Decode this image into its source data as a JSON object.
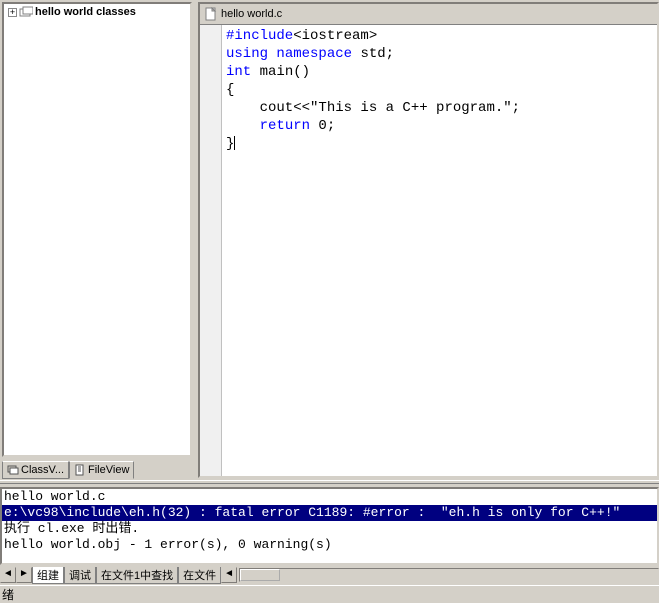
{
  "tree": {
    "expand_symbol": "+",
    "root_label": "hello world classes"
  },
  "editor": {
    "filename": "hello world.c",
    "code_tokens": [
      [
        {
          "t": "#include",
          "c": "kw"
        },
        {
          "t": "<iostream>",
          "c": ""
        }
      ],
      [
        {
          "t": "using",
          "c": "kw"
        },
        {
          "t": " ",
          "c": ""
        },
        {
          "t": "namespace",
          "c": "kw"
        },
        {
          "t": " std;",
          "c": ""
        }
      ],
      [
        {
          "t": "int",
          "c": "kw"
        },
        {
          "t": " main()",
          "c": ""
        }
      ],
      [
        {
          "t": "{",
          "c": ""
        }
      ],
      [
        {
          "t": "    cout<<",
          "c": ""
        },
        {
          "t": "\"This is a C++ program.\"",
          "c": ""
        },
        {
          "t": ";",
          "c": ""
        }
      ],
      [
        {
          "t": "    ",
          "c": ""
        },
        {
          "t": "return",
          "c": "kw"
        },
        {
          "t": " 0;",
          "c": ""
        }
      ],
      [
        {
          "t": "}",
          "c": ""
        }
      ]
    ]
  },
  "left_tabs": {
    "classview": "ClassV...",
    "fileview": "FileView"
  },
  "output": {
    "line1": "hello world.c",
    "line2": "e:\\vc98\\include\\eh.h(32) : fatal error C1189: #error :  \"eh.h is only for C++!\"",
    "line3": "执行 cl.exe 时出错.",
    "line4": "",
    "line5": "hello world.obj - 1 error(s), 0 warning(s)"
  },
  "output_tabs": {
    "t1": "组建",
    "t2": "调试",
    "t3": "在文件1中查找",
    "t4": "在文件"
  },
  "status": "绪"
}
